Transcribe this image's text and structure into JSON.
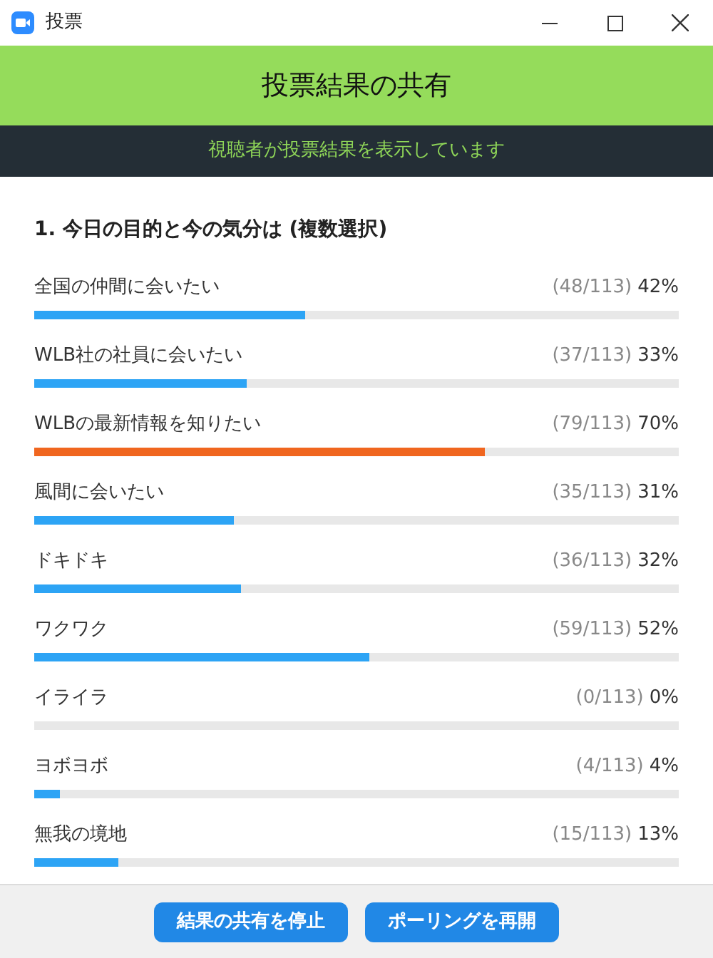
{
  "window": {
    "title": "投票"
  },
  "header": {
    "title": "投票結果の共有"
  },
  "banner": {
    "text": "視聴者が投票結果を表示しています"
  },
  "question": {
    "title": "1. 今日の目的と今の気分は (複数選択)",
    "options": [
      {
        "label": "全国の仲間に会いたい",
        "count": "(48/113)",
        "percent": "42%",
        "level": 0.42,
        "highlighted": false
      },
      {
        "label": "WLB社の社員に会いたい",
        "count": "(37/113)",
        "percent": "33%",
        "level": 0.33,
        "highlighted": false
      },
      {
        "label": "WLBの最新情報を知りたい",
        "count": "(79/113)",
        "percent": "70%",
        "level": 0.7,
        "highlighted": true
      },
      {
        "label": "風間に会いたい",
        "count": "(35/113)",
        "percent": "31%",
        "level": 0.31,
        "highlighted": false
      },
      {
        "label": "ドキドキ",
        "count": "(36/113)",
        "percent": "32%",
        "level": 0.32,
        "highlighted": false
      },
      {
        "label": "ワクワク",
        "count": "(59/113)",
        "percent": "52%",
        "level": 0.52,
        "highlighted": false
      },
      {
        "label": "イライラ",
        "count": "(0/113)",
        "percent": "0%",
        "level": 0
      },
      {
        "label": "ヨボヨボ",
        "count": "(4/113)",
        "percent": "4%",
        "level": 0.04,
        "highlighted": false
      },
      {
        "label": "無我の境地",
        "count": "(15/113)",
        "percent": "13%",
        "level": 0.13,
        "highlighted": false
      }
    ]
  },
  "buttons": [
    {
      "label": "結果の共有を停止"
    },
    {
      "label": "ポーリングを再開"
    }
  ]
}
